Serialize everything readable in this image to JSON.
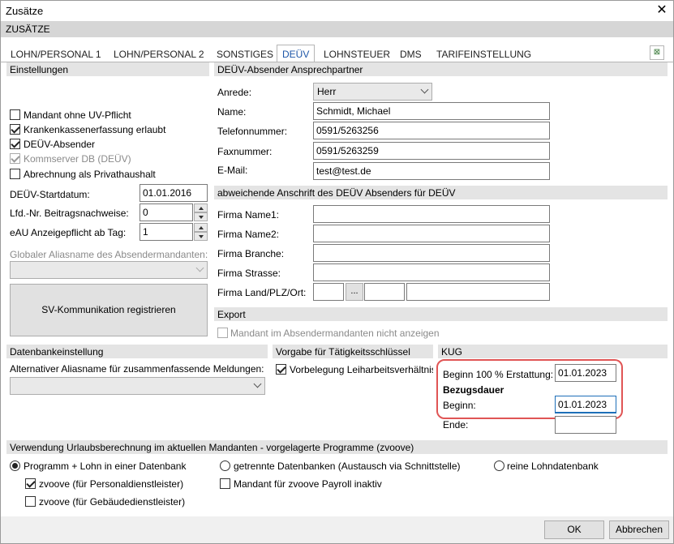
{
  "window": {
    "title": "Zusätze",
    "close_glyph": "✕"
  },
  "subheader": "ZUSÄTZE",
  "tabs": [
    {
      "label": "LOHN/PERSONAL 1"
    },
    {
      "label": "LOHN/PERSONAL 2"
    },
    {
      "label": "SONSTIGES"
    },
    {
      "label": "DEÜV"
    },
    {
      "label": "LOHNSTEUER"
    },
    {
      "label": "DMS"
    },
    {
      "label": "TARIFEINSTELLUNG"
    }
  ],
  "active_tab": "DEÜV",
  "einstellungen": {
    "header": "Einstellungen",
    "checkboxes": [
      {
        "label": "Mandant ohne UV-Pflicht",
        "checked": false,
        "enabled": true
      },
      {
        "label": "Krankenkassenerfassung erlaubt",
        "checked": true,
        "enabled": true
      },
      {
        "label": "DEÜV-Absender",
        "checked": true,
        "enabled": true
      },
      {
        "label": "Kommserver DB (DEÜV)",
        "checked": true,
        "enabled": false
      },
      {
        "label": "Abrechnung als Privathaushalt",
        "checked": false,
        "enabled": true
      }
    ],
    "startdatum_label": "DEÜV-Startdatum:",
    "startdatum_value": "01.01.2016",
    "lfdnr_label": "Lfd.-Nr. Beitragsnachweise:",
    "lfdnr_value": "0",
    "eau_label": "eAU Anzeigepflicht ab Tag:",
    "eau_value": "1",
    "alias_label": "Globaler Aliasname des Absendermandanten:",
    "alias_value": "",
    "register_button": "SV-Kommunikation registrieren"
  },
  "absender": {
    "header": "DEÜV-Absender Ansprechpartner",
    "anrede_label": "Anrede:",
    "anrede_value": "Herr",
    "name_label": "Name:",
    "name_value": "Schmidt, Michael",
    "telefon_label": "Telefonnummer:",
    "telefon_value": "0591/5263256",
    "fax_label": "Faxnummer:",
    "fax_value": "0591/5263259",
    "email_label": "E-Mail:",
    "email_value": "test@test.de"
  },
  "anschrift": {
    "header": "abweichende Anschrift des DEÜV Absenders für DEÜV",
    "firma_name1_label": "Firma Name1:",
    "firma_name2_label": "Firma Name2:",
    "firma_branche_label": "Firma Branche:",
    "firma_strasse_label": "Firma Strasse:",
    "firma_ort_label": "Firma Land/PLZ/Ort:",
    "browse_label": "..."
  },
  "export": {
    "header": "Export",
    "checkbox_label": "Mandant im Absendermandanten nicht anzeigen"
  },
  "datenbank": {
    "header": "Datenbankeinstellung",
    "alias_label": "Alternativer Aliasname für zusammenfassende Meldungen:"
  },
  "vorgabe": {
    "header": "Vorgabe für Tätigkeitsschlüssel",
    "checkbox_label": "Vorbelegung Leiharbeitsverhältnis"
  },
  "kug": {
    "header": "KUG",
    "beginn100_label": "Beginn 100 % Erstattung:",
    "beginn100_value": "01.01.2023",
    "bezugsdauer_label": "Bezugsdauer",
    "beginn_label": "Beginn:",
    "beginn_value": "01.01.2023",
    "ende_label": "Ende:",
    "ende_value": "",
    "highlight_color": "#e05555"
  },
  "urlaub": {
    "header": "Verwendung Urlaubsberechnung im aktuellen Mandanten - vorgelagerte Programme (zvoove)",
    "radio1": "Programm + Lohn in einer Datenbank",
    "radio2": "getrennte Datenbanken (Austausch via Schnittstelle)",
    "radio3": "reine Lohndatenbank",
    "cb_personal": "zvoove (für Personaldienstleister)",
    "cb_gebaeude": "zvoove (für Gebäudedienstleister)",
    "cb_payroll": "Mandant für zvoove Payroll inaktiv"
  },
  "buttons": {
    "ok": "OK",
    "cancel": "Abbrechen"
  }
}
